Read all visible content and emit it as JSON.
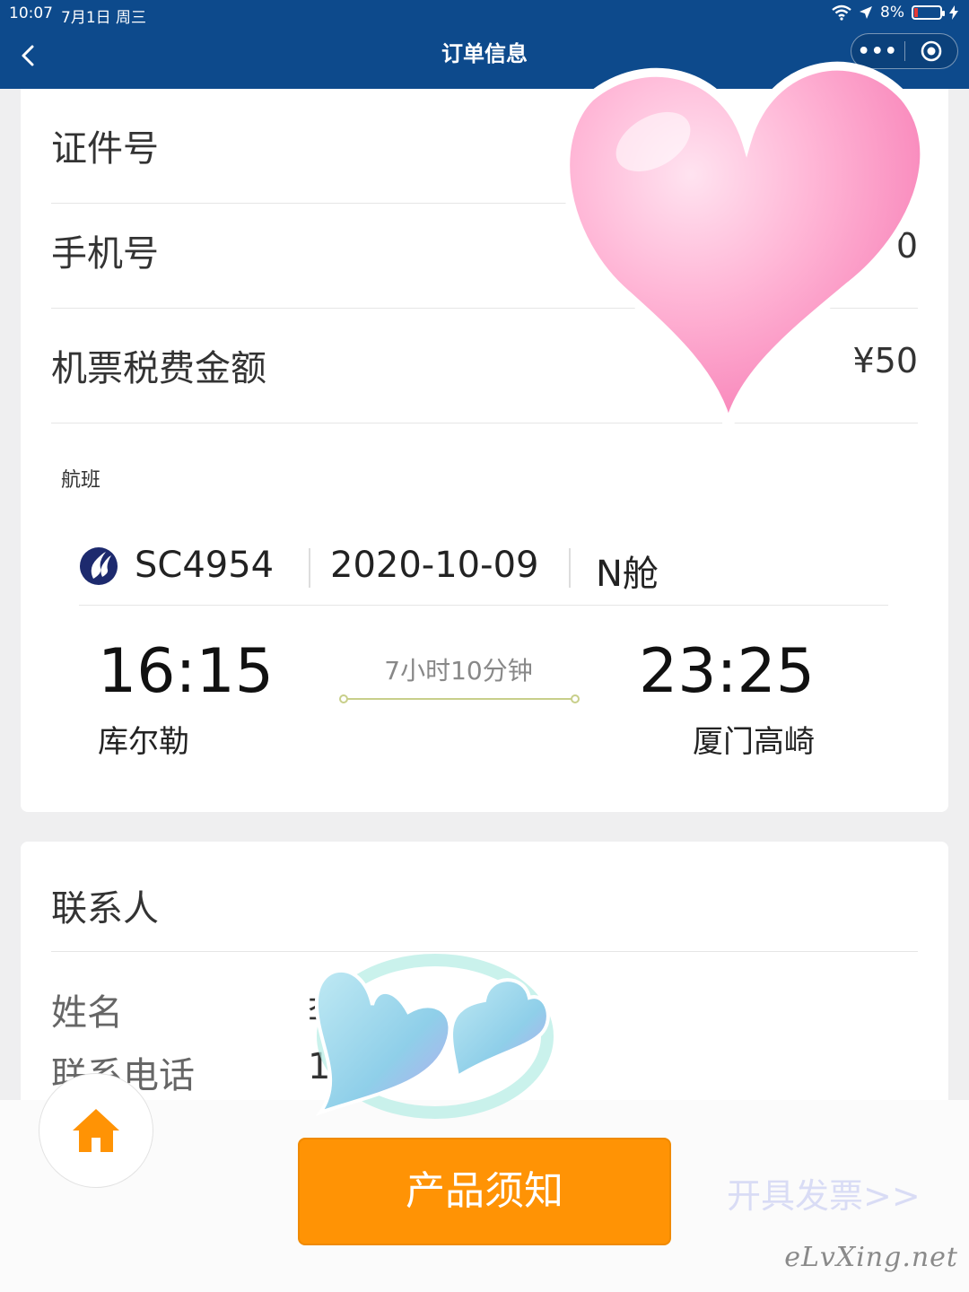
{
  "status_bar": {
    "time": "10:07",
    "date": "7月1日 周三",
    "battery": "8%"
  },
  "nav": {
    "title": "订单信息",
    "more_label": "•••"
  },
  "passenger": {
    "rows": [
      {
        "label": "证件号",
        "value": ""
      },
      {
        "label": "手机号",
        "value": "0"
      },
      {
        "label": "机票税费金额",
        "value": "¥50"
      }
    ]
  },
  "flight": {
    "section_label": "航班",
    "flight_no": "SC4954",
    "date": "2020-10-09",
    "cabin": "N舱",
    "departure_time": "16:15",
    "departure_city": "库尔勒",
    "arrival_time": "23:25",
    "arrival_city": "厦门高崎",
    "duration": "7小时10分钟"
  },
  "contact": {
    "title": "联系人",
    "name_label": "姓名",
    "name_value": "李",
    "phone_label": "联系电话",
    "phone_value": "1"
  },
  "bottom": {
    "product_button": "产品须知",
    "invoice_link": "开具发票>>"
  },
  "watermark": "eLvXing.net",
  "colors": {
    "nav_bg": "#0d4a8c",
    "primary_button": "#ff9305",
    "home_icon": "#ff9305",
    "duration_line": "#c8cf8a"
  },
  "icons": {
    "back": "chevron-left-icon",
    "capsule_close": "target-icon",
    "home": "home-icon",
    "airline": "sichuan-airlines-logo"
  }
}
